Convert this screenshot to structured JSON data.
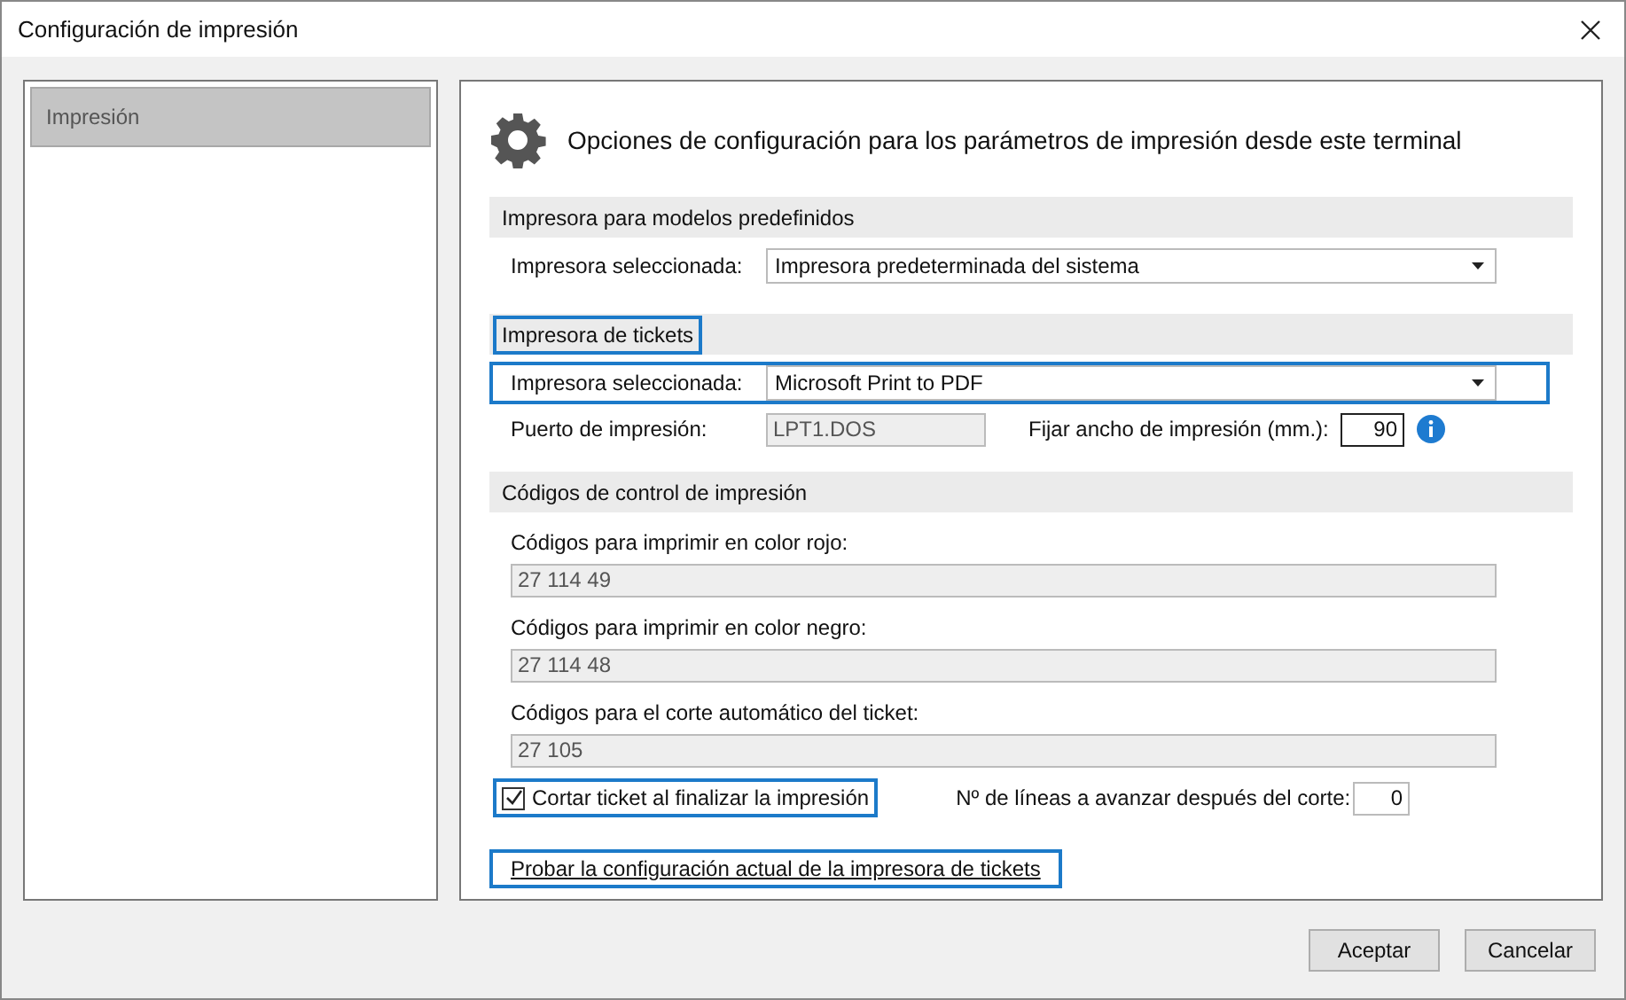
{
  "window": {
    "title": "Configuración de impresión"
  },
  "sidebar": {
    "items": [
      {
        "label": "Impresión",
        "selected": true
      }
    ]
  },
  "heading": "Opciones de configuración para los parámetros de impresión desde este terminal",
  "predefined": {
    "title": "Impresora para modelos predefinidos",
    "highlighted": false,
    "printer": {
      "label": "Impresora seleccionada:",
      "value": "Impresora predeterminada del sistema"
    }
  },
  "tickets": {
    "title": "Impresora de tickets",
    "highlighted": true,
    "printer": {
      "label": "Impresora seleccionada:",
      "value": "Microsoft Print to PDF",
      "highlighted": true
    },
    "port": {
      "label": "Puerto de impresión:",
      "value": "LPT1.DOS",
      "disabled": true
    },
    "width": {
      "label": "Fijar ancho de impresión (mm.):",
      "value": "90"
    }
  },
  "codes": {
    "title": "Códigos de control de impresión",
    "highlighted": false,
    "fields": [
      {
        "label": "Códigos para imprimir en color rojo:",
        "value": "27 114 49",
        "disabled": true
      },
      {
        "label": "Códigos para imprimir en color negro:",
        "value": "27 114 48",
        "disabled": true
      },
      {
        "label": "Códigos para el corte automático del ticket:",
        "value": "27 105",
        "disabled": true
      }
    ],
    "cut": {
      "label": "Cortar ticket al finalizar la impresión",
      "checked": true,
      "highlighted": true
    },
    "lines": {
      "label": "Nº de líneas a avanzar después del corte:",
      "value": "0"
    }
  },
  "test_link": {
    "label": "Probar la configuración actual de la impresora de tickets",
    "highlighted": true
  },
  "buttons": [
    {
      "label": "Aceptar"
    },
    {
      "label": "Cancelar"
    }
  ]
}
